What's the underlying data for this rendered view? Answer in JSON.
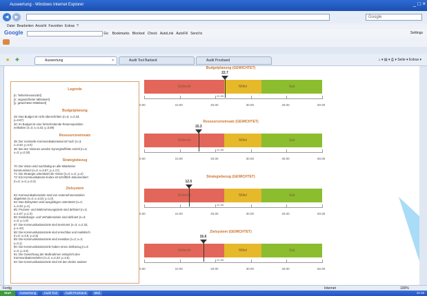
{
  "window": {
    "title": "Auswertung - Windows Internet Explorer",
    "controls": "_ □ ×"
  },
  "nav": {
    "back": "◄",
    "forward": "►",
    "search_placeholder": "Google"
  },
  "menu": [
    "Datei",
    "Bearbeiten",
    "Ansicht",
    "Favoriten",
    "Extras",
    "?"
  ],
  "google_toolbar": {
    "label": "Google",
    "items": [
      "Go",
      "Bookmarks",
      "Blocked",
      "Check",
      "AutoLink",
      "AutoFill",
      "Send to"
    ],
    "settings": "Settings"
  },
  "tabs": [
    {
      "label": "Auswertung",
      "active": true
    },
    {
      "label": "Audit Tool Barland",
      "active": false
    },
    {
      "label": "Audit Prozband",
      "active": false
    }
  ],
  "tab_toolbar": {
    "page": "Seite",
    "extras": "Extras"
  },
  "legend": {
    "title": "Legende",
    "keys": [
      "[n: Teilnehmeranzahl]",
      "[x: ungewichteter Mittelwert]",
      "[y: gewichteter Mittelwert]"
    ],
    "sections": [
      {
        "heading": "Budgetplanung",
        "lines": [
          "29: Das Budget ist nicht überschritten (n=3; x=3.33;",
          "y=3.67)",
          "30: Im Budget ist eine fortschreitende Reserveposition",
          "enthalten (n=3; x=4.33; y=3.89)"
        ]
      },
      {
        "heading": "Ressourceneinsatz",
        "lines": [
          "35: Der nominelle Kommunikationsetat ist hoch (n=3;",
          "x=3.33; y=3.0)",
          "36: Bei den Visionen werden Synergieeffekte erzielt (n=3;",
          "x=3; y=2.33)"
        ]
      },
      {
        "heading": "Strategiebezug",
        "lines": [
          "70: Die Vision wird nachhaltig an alle Mitarbeiter",
          "kommuniziert (n=3; x=3.67; y=1.17)",
          "71: Die Strategie unterstützt die Vision (n=3; x=2; y=2)",
          "72: Ein Kommunikations-Kodex ist schriftlich dokumentiert",
          "(n=3; x=3; y=0.3)"
        ]
      },
      {
        "heading": "Zielsystem",
        "lines": [
          "83: Kommunikationsziele sind von Unternehmenszielen",
          "abgeleitet (n=3; x=3.33; y=1.0)",
          "84: Das Zielsystem wird ausgiebigen unterstützt (n=3;",
          "x=3.33; y=1)",
          "85: Prozess- und Wahrnehmungsziele sind definiert (n=3;",
          "x=1.67; y=1.0)",
          "86: Einstellungs- und Verhaltensziele sind definiert (n=3;",
          "x=3; y=1.8)",
          "87: Die Kommunikationsziele sind terminiert (n=3; x=2.33;",
          "y=1.44)",
          "88: Die Kommunikationsziele sind erreichbar und realistisch",
          "(n=3; x=3.5; y=2.5)",
          "89: Die Kommunikationsziele sind messbar (n=3; x=3;",
          "y=3.1)",
          "90: Die Kommunikationsziele haben einen Zeitbezug (n=3;",
          "x=4; y=4.5)",
          "91: Die Gewichtung der Maßnahmen entspricht den",
          "Kommunikationszielen (n=3; x=2.33; y=2.5)",
          "92: Die Kommunikationsziele sind mit den Zielen anderer"
        ]
      }
    ]
  },
  "charts": [
    {
      "title": "Budgetplanung (GEWICHTET)",
      "value": "22.7",
      "mean_label": "21.55",
      "bands": [
        "Schlecht",
        "Mittel",
        "Gut"
      ]
    },
    {
      "title": "Ressourceneinsatz (GEWICHTET)",
      "value": "15.3",
      "mean_label": "21.55",
      "bands": [
        "Schlecht",
        "Mittel",
        "Gut"
      ]
    },
    {
      "title": "Strategiebezug (GEWICHTET)",
      "value": "12.5",
      "mean_label": "21.55",
      "bands": [
        "Schlecht",
        "Mittel",
        "Gut"
      ]
    },
    {
      "title": "Zielsystem (GEWICHTET)",
      "value": "16.6",
      "mean_label": "21.55",
      "bands": [
        "Schlecht",
        "Mittel",
        "Gut"
      ]
    }
  ],
  "chart_data": [
    {
      "type": "bar",
      "title": "Budgetplanung (GEWICHTET)",
      "x": [
        22.7
      ],
      "xlim": [
        0,
        50
      ],
      "ticks": [
        "0.00",
        "10.00",
        "20.00",
        "30.00",
        "40.00",
        "50.00"
      ],
      "bands": [
        {
          "label": "Schlecht",
          "from": 0,
          "to": 22.5,
          "color": "#e3665a"
        },
        {
          "label": "Mittel",
          "from": 22.5,
          "to": 33,
          "color": "#e6b92a"
        },
        {
          "label": "Gut",
          "from": 33,
          "to": 50,
          "color": "#8bbd2e"
        }
      ],
      "reference": 21.55
    },
    {
      "type": "bar",
      "title": "Ressourceneinsatz (GEWICHTET)",
      "x": [
        15.3
      ],
      "xlim": [
        0,
        50
      ],
      "ticks": [
        "0.00",
        "10.00",
        "20.00",
        "30.00",
        "40.00",
        "50.00"
      ],
      "bands": [
        {
          "label": "Schlecht",
          "from": 0,
          "to": 22.5,
          "color": "#e3665a"
        },
        {
          "label": "Mittel",
          "from": 22.5,
          "to": 33,
          "color": "#e6b92a"
        },
        {
          "label": "Gut",
          "from": 33,
          "to": 50,
          "color": "#8bbd2e"
        }
      ],
      "reference": 21.55
    },
    {
      "type": "bar",
      "title": "Strategiebezug (GEWICHTET)",
      "x": [
        12.5
      ],
      "xlim": [
        0,
        50
      ],
      "ticks": [
        "0.00",
        "10.00",
        "20.00",
        "30.00",
        "40.00",
        "50.00"
      ],
      "bands": [
        {
          "label": "Schlecht",
          "from": 0,
          "to": 22.5,
          "color": "#e3665a"
        },
        {
          "label": "Mittel",
          "from": 22.5,
          "to": 33,
          "color": "#e6b92a"
        },
        {
          "label": "Gut",
          "from": 33,
          "to": 50,
          "color": "#8bbd2e"
        }
      ],
      "reference": 21.55
    },
    {
      "type": "bar",
      "title": "Zielsystem (GEWICHTET)",
      "x": [
        16.6
      ],
      "xlim": [
        0,
        50
      ],
      "ticks": [
        "0.00",
        "10.00",
        "20.00",
        "30.00",
        "40.00",
        "50.00"
      ],
      "bands": [
        {
          "label": "Schlecht",
          "from": 0,
          "to": 22.5,
          "color": "#e3665a"
        },
        {
          "label": "Mittel",
          "from": 22.5,
          "to": 33,
          "color": "#e6b92a"
        },
        {
          "label": "Gut",
          "from": 33,
          "to": 50,
          "color": "#8bbd2e"
        }
      ],
      "reference": 21.55
    }
  ],
  "status": {
    "left": "Fertig",
    "zone": "Internet",
    "zoom": "100%"
  },
  "taskbar": {
    "start": "Start",
    "items": [
      "Auswertung",
      "Audit Tool",
      "Audit Prozband",
      "Mail"
    ],
    "clock": "10:15"
  }
}
